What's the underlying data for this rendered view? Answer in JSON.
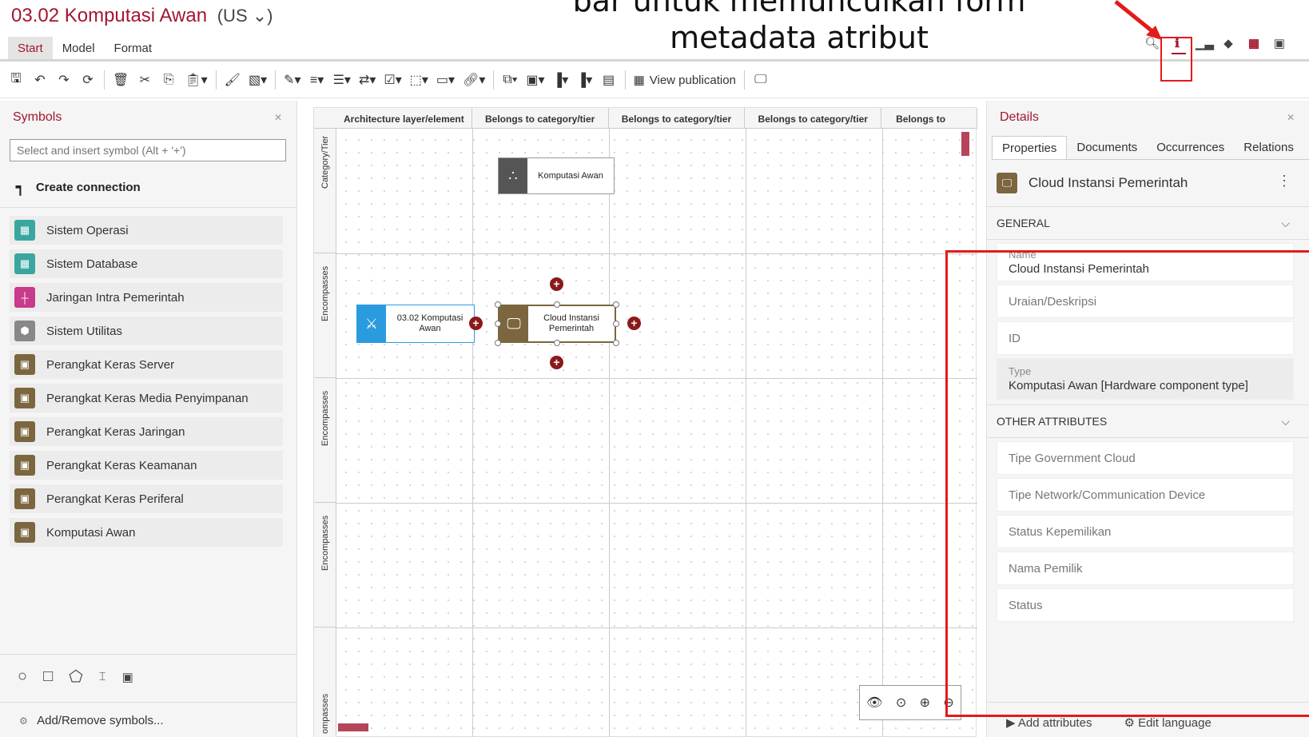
{
  "title": "03.02 Komputasi Awan",
  "title_lang": "(US ⌄)",
  "annotation": {
    "line1": "bar untuk memunculkan form",
    "line2": "metadata atribut"
  },
  "ribbon_tabs": [
    "Start",
    "Model",
    "Format"
  ],
  "toolbar": {
    "view_publication": "View publication"
  },
  "symbols": {
    "header": "Symbols",
    "search_placeholder": "Select and insert symbol (Alt + '+')",
    "create_connection": "Create connection",
    "items": [
      {
        "label": "Sistem Operasi",
        "color": "#3aa6a0",
        "icon": "os-icon"
      },
      {
        "label": "Sistem Database",
        "color": "#3aa6a0",
        "icon": "database-icon"
      },
      {
        "label": "Jaringan Intra Pemerintah",
        "color": "#c83a8a",
        "icon": "network-icon"
      },
      {
        "label": "Sistem Utilitas",
        "color": "#888888",
        "icon": "utility-icon"
      },
      {
        "label": "Perangkat Keras Server",
        "color": "#7b6640",
        "icon": "monitor-icon"
      },
      {
        "label": "Perangkat Keras Media Penyimpanan",
        "color": "#7b6640",
        "icon": "monitor-icon"
      },
      {
        "label": "Perangkat Keras Jaringan",
        "color": "#7b6640",
        "icon": "monitor-icon"
      },
      {
        "label": "Perangkat Keras Keamanan",
        "color": "#7b6640",
        "icon": "monitor-icon"
      },
      {
        "label": "Perangkat Keras Periferal",
        "color": "#7b6640",
        "icon": "monitor-icon"
      },
      {
        "label": "Komputasi Awan",
        "color": "#7b6640",
        "icon": "monitor-icon"
      }
    ],
    "add_remove": "Add/Remove symbols..."
  },
  "canvas": {
    "columns": [
      "Architecture layer/element",
      "Belongs to category/tier",
      "Belongs to category/tier",
      "Belongs to category/tier",
      "Belongs to"
    ],
    "rows": [
      "Category/Tier",
      "Encompasses",
      "Encompasses",
      "Encompasses",
      "ompasses"
    ],
    "nodes": {
      "komputasi_awan": "Komputasi Awan",
      "node_0302": "03.02 Komputasi Awan",
      "cloud_instansi": "Cloud Instansi Pemerintah"
    }
  },
  "details": {
    "header": "Details",
    "tabs": [
      "Properties",
      "Documents",
      "Occurrences",
      "Relations"
    ],
    "object_name": "Cloud Instansi Pemerintah",
    "general_header": "GENERAL",
    "name_label": "Name",
    "name_value": "Cloud Instansi Pemerintah",
    "uraian": "Uraian/Deskripsi",
    "id": "ID",
    "type_label": "Type",
    "type_value": "Komputasi Awan [Hardware component type]",
    "other_header": "OTHER ATTRIBUTES",
    "other_fields": [
      "Tipe Government Cloud",
      "Tipe Network/Communication Device",
      "Status Kepemilikan",
      "Nama Pemilik",
      "Status"
    ],
    "add_attributes": "Add attributes",
    "edit_language": "Edit language"
  },
  "colors": {
    "brand": "#a3172f",
    "annotation_red": "#e21b1b",
    "node_blue": "#2b9be0",
    "node_brown": "#7b6640",
    "node_dark": "#555555"
  }
}
